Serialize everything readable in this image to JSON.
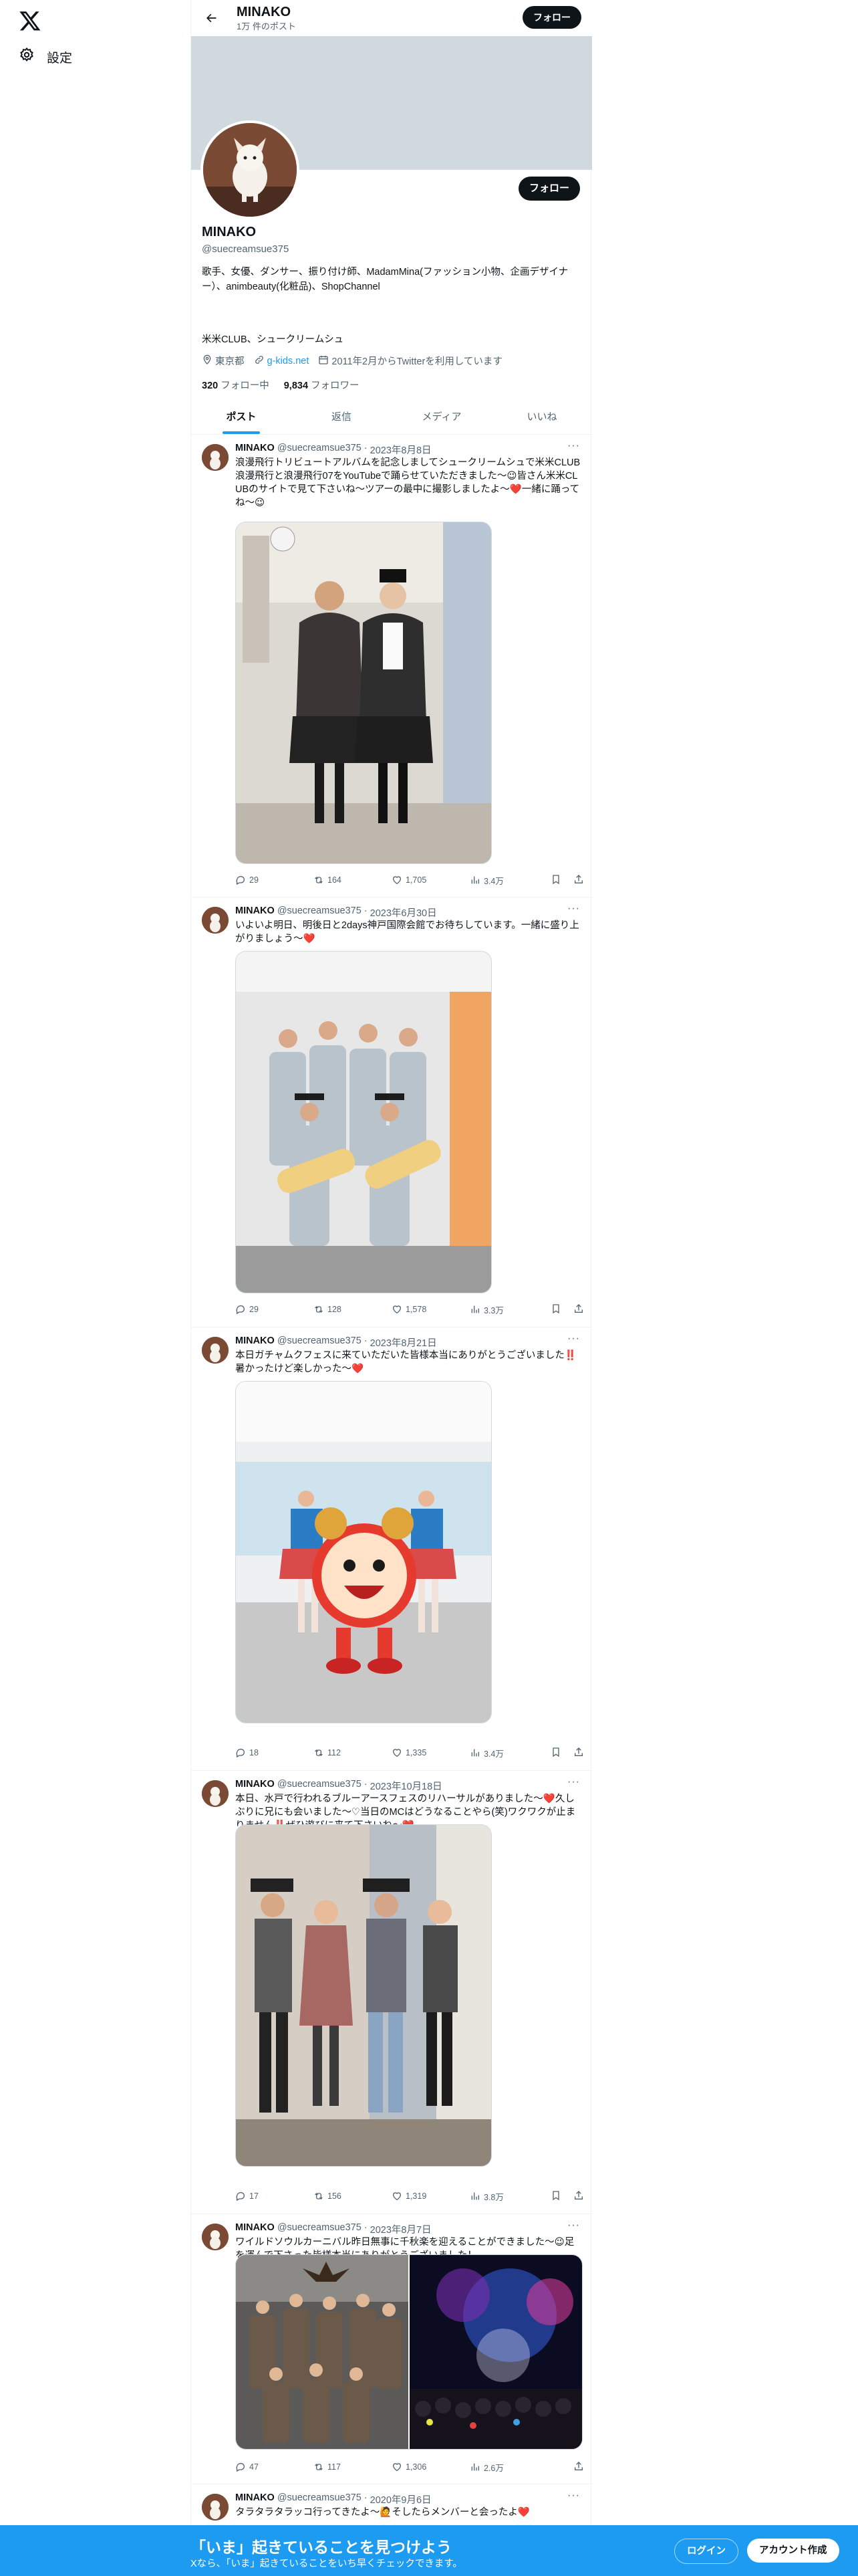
{
  "sidebar": {
    "settings_label": "設定"
  },
  "header": {
    "name": "MINAKO",
    "post_count": "1万 件のポスト",
    "follow_label": "フォロー"
  },
  "profile": {
    "name": "MINAKO",
    "handle": "@suecreamsue375",
    "bio": "歌手、女優、ダンサー、振り付け師、MadamMina(ファッション小物、企画デザイナー）、animbeauty(化粧品)、ShopChannel",
    "bio_line2": "米米CLUB、シュークリームシュ",
    "location": "東京都",
    "website": "g-kids.net",
    "joined": "2011年2月からTwitterを利用しています",
    "following_count": "320",
    "following_label": "フォロー中",
    "followers_count": "9,834",
    "followers_label": "フォロワー",
    "follow_label": "フォロー"
  },
  "tabs": [
    "ポスト",
    "返信",
    "メディア",
    "いいね"
  ],
  "tweets": [
    {
      "name": "MINAKO",
      "handle": "@suecreamsue375",
      "date": "2023年8月8日",
      "text": "浪漫飛行トリビュートアルバムを記念しましてシュークリームシュで米米CLUB浪漫飛行と浪漫飛行07をYouTubeで踊らせていただきました〜😉皆さん米米CLUBのサイトで見て下さいね〜ツアーの最中に撮影しましたよ〜❤️一緒に踊ってね〜😉",
      "replies": "29",
      "reposts": "164",
      "likes": "1,705",
      "views": "3.4万"
    },
    {
      "name": "MINAKO",
      "handle": "@suecreamsue375",
      "date": "2023年6月30日",
      "text": "いよいよ明日、明後日と2days神戸国際会館でお待ちしています。一緒に盛り上がりましょう〜❤️",
      "replies": "29",
      "reposts": "128",
      "likes": "1,578",
      "views": "3.3万"
    },
    {
      "name": "MINAKO",
      "handle": "@suecreamsue375",
      "date": "2023年8月21日",
      "text": "本日ガチャムクフェスに来ていただいた皆様本当にありがとうございました‼️暑かったけど楽しかった〜❤️",
      "replies": "18",
      "reposts": "112",
      "likes": "1,335",
      "views": "3.4万"
    },
    {
      "name": "MINAKO",
      "handle": "@suecreamsue375",
      "date": "2023年10月18日",
      "text": "本日、水戸で行われるブルーアースフェスのリハーサルがありました〜❤️久しぶりに兄にも会いました〜♡当日のMCはどうなることやら(笑)ワクワクが止まりません‼️ぜひ遊びに来て下さいね〜❤️",
      "replies": "17",
      "reposts": "156",
      "likes": "1,319",
      "views": "3.8万"
    },
    {
      "name": "MINAKO",
      "handle": "@suecreamsue375",
      "date": "2023年8月7日",
      "text": "ワイルドソウルカーニバル昨日無事に千秋楽を迎えることができました〜😉足を運んで下さった皆様本当にありがとうございました！",
      "replies": "47",
      "reposts": "117",
      "likes": "1,306",
      "views": "2.6万"
    },
    {
      "name": "MINAKO",
      "handle": "@suecreamsue375",
      "date": "2020年9月6日",
      "text": "タラタラタラッコ行ってきたよ〜🙋そしたらメンバーと会ったよ❤️"
    }
  ],
  "bottom_bar": {
    "title": "「いま」起きていることを見つけよう",
    "subtitle": "Xなら、「いま」起きていることをいち早くチェックできます。",
    "login": "ログイン",
    "signup": "アカウント作成"
  },
  "colors": {
    "accent": "#1d9bf0",
    "text": "#0f1419",
    "muted": "#536471",
    "banner": "#cfd9de"
  }
}
